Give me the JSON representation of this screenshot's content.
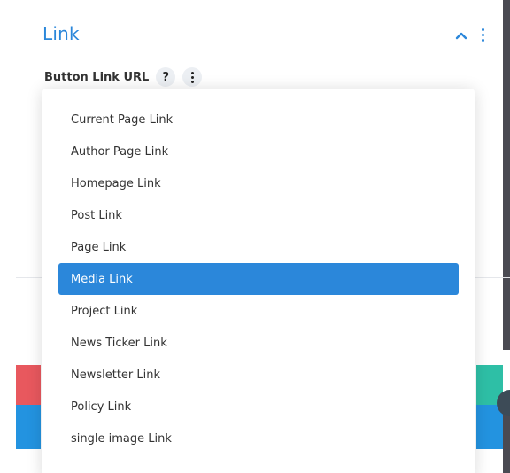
{
  "section": {
    "title": "Link",
    "chevron_icon": "chevron-up-icon",
    "menu_icon": "kebab-icon"
  },
  "field": {
    "label": "Button Link URL",
    "help_label": "?"
  },
  "dropdown": {
    "items": [
      "Current Page Link",
      "Author Page Link",
      "Homepage Link",
      "Post Link",
      "Page Link",
      "Media Link",
      "Project Link",
      "News Ticker Link",
      "Newsletter Link",
      "Policy Link",
      "single image Link"
    ],
    "selected": "Media Link"
  },
  "colors": {
    "accent": "#2b87da",
    "red": "#e8585e",
    "teal": "#2ebfa6",
    "blue": "#2393e0"
  }
}
